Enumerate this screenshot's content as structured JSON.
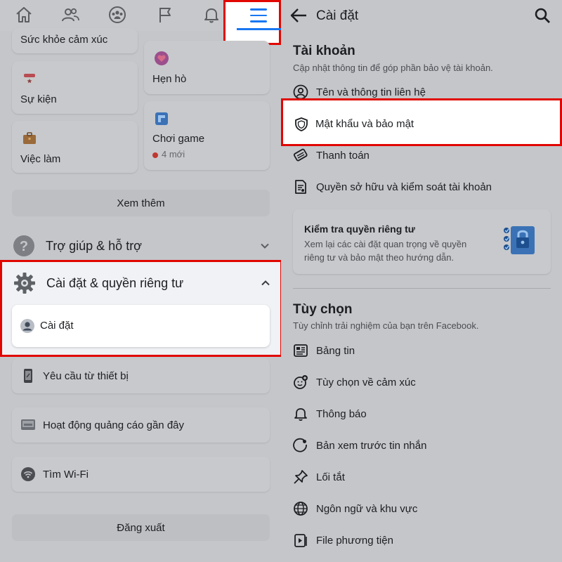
{
  "colors": {
    "accent": "#1877f2",
    "highlight_border": "#e10600",
    "new_dot": "#c0382f"
  },
  "left": {
    "top_nav": {
      "icons": [
        "home-icon",
        "friends-icon",
        "groups-icon",
        "pages-flag-icon",
        "notifications-bell-icon",
        "menu-icon"
      ]
    },
    "cards": {
      "emotional_health": "Sức khỏe cảm xúc",
      "dating": "Hẹn hò",
      "events": "Sự kiện",
      "gaming": "Chơi game",
      "gaming_badge": "4 mới",
      "jobs": "Việc làm"
    },
    "see_more": "Xem thêm",
    "help_support": "Trợ giúp & hỗ trợ",
    "settings_privacy": "Cài đặt & quyền riêng tư",
    "settings": "Cài đặt",
    "device_requests": "Yêu cầu từ thiết bị",
    "recent_ad_activity": "Hoạt động quảng cáo gần đây",
    "find_wifi": "Tìm Wi-Fi",
    "logout": "Đăng xuất"
  },
  "right": {
    "header": {
      "title": "Cài đặt",
      "back_icon": "arrow-left-icon",
      "search_icon": "search-icon"
    },
    "account": {
      "title": "Tài khoản",
      "description": "Cập nhật thông tin để góp phần bảo vệ tài khoản.",
      "items": [
        {
          "label": "Tên và thông tin liên hệ",
          "icon": "user-circle-icon"
        },
        {
          "label": "Mật khẩu và bảo mật",
          "icon": "shield-icon"
        },
        {
          "label": "Thanh toán",
          "icon": "tag-icon"
        },
        {
          "label": "Quyền sở hữu và kiểm soát tài khoản",
          "icon": "document-icon"
        }
      ]
    },
    "privacy_checkup": {
      "title": "Kiểm tra quyền riêng tư",
      "description": "Xem lại các cài đặt quan trọng về quyền riêng tư và bảo mật theo hướng dẫn."
    },
    "preferences": {
      "title": "Tùy chọn",
      "description": "Tùy chỉnh trải nghiệm của bạn trên Facebook.",
      "items": [
        {
          "label": "Bảng tin",
          "icon": "news-feed-icon"
        },
        {
          "label": "Tùy chọn về cảm xúc",
          "icon": "reaction-icon"
        },
        {
          "label": "Thông báo",
          "icon": "bell-icon"
        },
        {
          "label": "Bản xem trước tin nhắn",
          "icon": "message-preview-icon"
        },
        {
          "label": "Lối tắt",
          "icon": "pin-icon"
        },
        {
          "label": "Ngôn ngữ và khu vực",
          "icon": "globe-icon"
        },
        {
          "label": "File phương tiện",
          "icon": "media-icon"
        }
      ]
    }
  }
}
